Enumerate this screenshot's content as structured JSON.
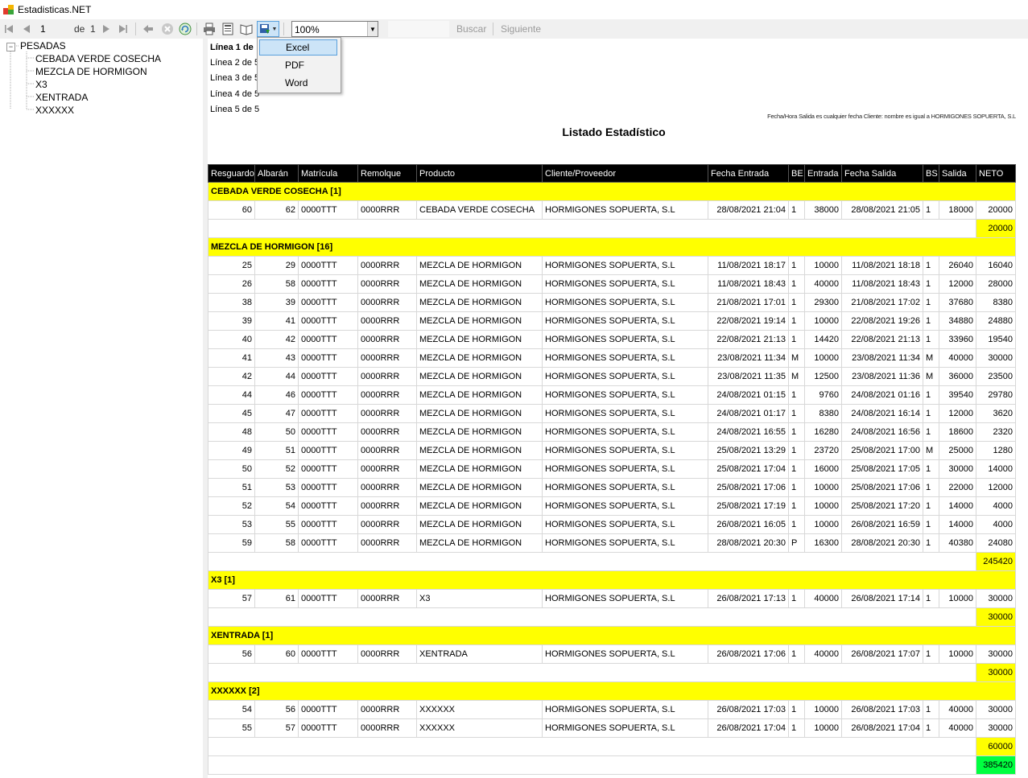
{
  "window": {
    "title": "Estadisticas.NET"
  },
  "toolbar": {
    "page_current": "1",
    "page_of_label": "de",
    "page_total": "1",
    "zoom_value": "100%",
    "search_label": "Buscar",
    "next_label": "Siguiente"
  },
  "export_menu": {
    "items": [
      "Excel",
      "PDF",
      "Word"
    ]
  },
  "tree": {
    "root": "PESADAS",
    "children": [
      "CEBADA VERDE COSECHA",
      "MEZCLA DE HORMIGON",
      "X3",
      "XENTRADA",
      "XXXXXX"
    ]
  },
  "report": {
    "lines": [
      "Línea 1 de",
      "Línea 2 de 5",
      "Línea 3 de 5",
      "Línea 4 de 5",
      "Línea 5 de 5"
    ],
    "filter_text": "Fecha/Hora Salida es cualquier fecha Cliente: nombre es igual a HORMIGONES SOPUERTA, S.L",
    "title": "Listado Estadístico",
    "columns": [
      "Resguardo",
      "Albarán",
      "Matrícula",
      "Remolque",
      "Producto",
      "Cliente/Proveedor",
      "Fecha Entrada",
      "BE",
      "Entrada",
      "Fecha Salida",
      "BS",
      "Salida",
      "NETO"
    ],
    "groups": [
      {
        "header": "CEBADA VERDE COSECHA [1]",
        "subtotal": "20000",
        "rows": [
          [
            "60",
            "62",
            "0000TTT",
            "0000RRR",
            "CEBADA VERDE COSECHA",
            "HORMIGONES SOPUERTA, S.L",
            "28/08/2021 21:04",
            "1",
            "38000",
            "28/08/2021 21:05",
            "1",
            "18000",
            "20000"
          ]
        ]
      },
      {
        "header": "MEZCLA DE HORMIGON [16]",
        "subtotal": "245420",
        "rows": [
          [
            "25",
            "29",
            "0000TTT",
            "0000RRR",
            "MEZCLA DE HORMIGON",
            "HORMIGONES SOPUERTA, S.L",
            "11/08/2021 18:17",
            "1",
            "10000",
            "11/08/2021 18:18",
            "1",
            "26040",
            "16040"
          ],
          [
            "26",
            "58",
            "0000TTT",
            "0000RRR",
            "MEZCLA DE HORMIGON",
            "HORMIGONES SOPUERTA, S.L",
            "11/08/2021 18:43",
            "1",
            "40000",
            "11/08/2021 18:43",
            "1",
            "12000",
            "28000"
          ],
          [
            "38",
            "39",
            "0000TTT",
            "0000RRR",
            "MEZCLA DE HORMIGON",
            "HORMIGONES SOPUERTA, S.L",
            "21/08/2021 17:01",
            "1",
            "29300",
            "21/08/2021 17:02",
            "1",
            "37680",
            "8380"
          ],
          [
            "39",
            "41",
            "0000TTT",
            "0000RRR",
            "MEZCLA DE HORMIGON",
            "HORMIGONES SOPUERTA, S.L",
            "22/08/2021 19:14",
            "1",
            "10000",
            "22/08/2021 19:26",
            "1",
            "34880",
            "24880"
          ],
          [
            "40",
            "42",
            "0000TTT",
            "0000RRR",
            "MEZCLA DE HORMIGON",
            "HORMIGONES SOPUERTA, S.L",
            "22/08/2021 21:13",
            "1",
            "14420",
            "22/08/2021 21:13",
            "1",
            "33960",
            "19540"
          ],
          [
            "41",
            "43",
            "0000TTT",
            "0000RRR",
            "MEZCLA DE HORMIGON",
            "HORMIGONES SOPUERTA, S.L",
            "23/08/2021 11:34",
            "M",
            "10000",
            "23/08/2021 11:34",
            "M",
            "40000",
            "30000"
          ],
          [
            "42",
            "44",
            "0000TTT",
            "0000RRR",
            "MEZCLA DE HORMIGON",
            "HORMIGONES SOPUERTA, S.L",
            "23/08/2021 11:35",
            "M",
            "12500",
            "23/08/2021 11:36",
            "M",
            "36000",
            "23500"
          ],
          [
            "44",
            "46",
            "0000TTT",
            "0000RRR",
            "MEZCLA DE HORMIGON",
            "HORMIGONES SOPUERTA, S.L",
            "24/08/2021 01:15",
            "1",
            "9760",
            "24/08/2021 01:16",
            "1",
            "39540",
            "29780"
          ],
          [
            "45",
            "47",
            "0000TTT",
            "0000RRR",
            "MEZCLA DE HORMIGON",
            "HORMIGONES SOPUERTA, S.L",
            "24/08/2021 01:17",
            "1",
            "8380",
            "24/08/2021 16:14",
            "1",
            "12000",
            "3620"
          ],
          [
            "48",
            "50",
            "0000TTT",
            "0000RRR",
            "MEZCLA DE HORMIGON",
            "HORMIGONES SOPUERTA, S.L",
            "24/08/2021 16:55",
            "1",
            "16280",
            "24/08/2021 16:56",
            "1",
            "18600",
            "2320"
          ],
          [
            "49",
            "51",
            "0000TTT",
            "0000RRR",
            "MEZCLA DE HORMIGON",
            "HORMIGONES SOPUERTA, S.L",
            "25/08/2021 13:29",
            "1",
            "23720",
            "25/08/2021 17:00",
            "M",
            "25000",
            "1280"
          ],
          [
            "50",
            "52",
            "0000TTT",
            "0000RRR",
            "MEZCLA DE HORMIGON",
            "HORMIGONES SOPUERTA, S.L",
            "25/08/2021 17:04",
            "1",
            "16000",
            "25/08/2021 17:05",
            "1",
            "30000",
            "14000"
          ],
          [
            "51",
            "53",
            "0000TTT",
            "0000RRR",
            "MEZCLA DE HORMIGON",
            "HORMIGONES SOPUERTA, S.L",
            "25/08/2021 17:06",
            "1",
            "10000",
            "25/08/2021 17:06",
            "1",
            "22000",
            "12000"
          ],
          [
            "52",
            "54",
            "0000TTT",
            "0000RRR",
            "MEZCLA DE HORMIGON",
            "HORMIGONES SOPUERTA, S.L",
            "25/08/2021 17:19",
            "1",
            "10000",
            "25/08/2021 17:20",
            "1",
            "14000",
            "4000"
          ],
          [
            "53",
            "55",
            "0000TTT",
            "0000RRR",
            "MEZCLA DE HORMIGON",
            "HORMIGONES SOPUERTA, S.L",
            "26/08/2021 16:05",
            "1",
            "10000",
            "26/08/2021 16:59",
            "1",
            "14000",
            "4000"
          ],
          [
            "59",
            "58",
            "0000TTT",
            "0000RRR",
            "MEZCLA DE HORMIGON",
            "HORMIGONES SOPUERTA, S.L",
            "28/08/2021 20:30",
            "P",
            "16300",
            "28/08/2021 20:30",
            "1",
            "40380",
            "24080"
          ]
        ]
      },
      {
        "header": "X3 [1]",
        "subtotal": "30000",
        "rows": [
          [
            "57",
            "61",
            "0000TTT",
            "0000RRR",
            "X3",
            "HORMIGONES SOPUERTA, S.L",
            "26/08/2021 17:13",
            "1",
            "40000",
            "26/08/2021 17:14",
            "1",
            "10000",
            "30000"
          ]
        ]
      },
      {
        "header": "XENTRADA [1]",
        "subtotal": "30000",
        "rows": [
          [
            "56",
            "60",
            "0000TTT",
            "0000RRR",
            "XENTRADA",
            "HORMIGONES SOPUERTA, S.L",
            "26/08/2021 17:06",
            "1",
            "40000",
            "26/08/2021 17:07",
            "1",
            "10000",
            "30000"
          ]
        ]
      },
      {
        "header": "XXXXXX [2]",
        "subtotal": "60000",
        "rows": [
          [
            "54",
            "56",
            "0000TTT",
            "0000RRR",
            "XXXXXX",
            "HORMIGONES SOPUERTA, S.L",
            "26/08/2021 17:03",
            "1",
            "10000",
            "26/08/2021 17:03",
            "1",
            "40000",
            "30000"
          ],
          [
            "55",
            "57",
            "0000TTT",
            "0000RRR",
            "XXXXXX",
            "HORMIGONES SOPUERTA, S.L",
            "26/08/2021 17:04",
            "1",
            "10000",
            "26/08/2021 17:04",
            "1",
            "40000",
            "30000"
          ]
        ]
      }
    ],
    "grand_total": "385420"
  },
  "colors": {
    "group_header": "#ffff00",
    "grand_total": "#00ff40",
    "menu_highlight": "#cce4f7"
  }
}
